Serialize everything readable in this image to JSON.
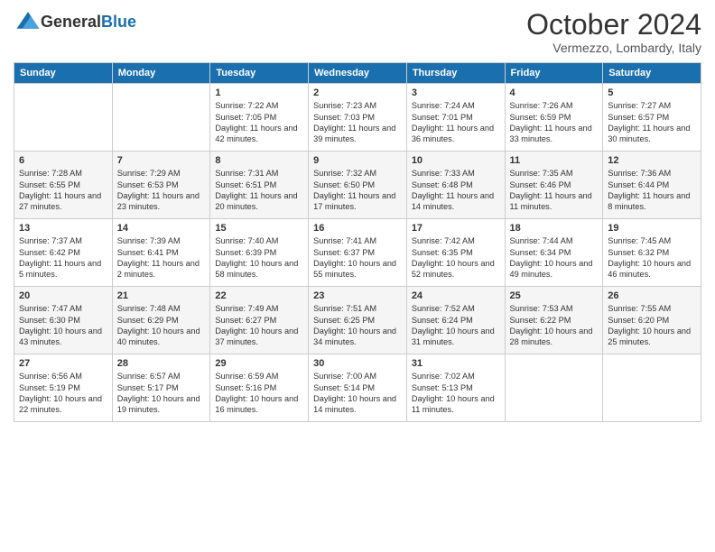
{
  "header": {
    "logo_general": "General",
    "logo_blue": "Blue",
    "month": "October 2024",
    "location": "Vermezzo, Lombardy, Italy"
  },
  "weekdays": [
    "Sunday",
    "Monday",
    "Tuesday",
    "Wednesday",
    "Thursday",
    "Friday",
    "Saturday"
  ],
  "weeks": [
    [
      {
        "day": "",
        "info": ""
      },
      {
        "day": "",
        "info": ""
      },
      {
        "day": "1",
        "info": "Sunrise: 7:22 AM\nSunset: 7:05 PM\nDaylight: 11 hours and 42 minutes."
      },
      {
        "day": "2",
        "info": "Sunrise: 7:23 AM\nSunset: 7:03 PM\nDaylight: 11 hours and 39 minutes."
      },
      {
        "day": "3",
        "info": "Sunrise: 7:24 AM\nSunset: 7:01 PM\nDaylight: 11 hours and 36 minutes."
      },
      {
        "day": "4",
        "info": "Sunrise: 7:26 AM\nSunset: 6:59 PM\nDaylight: 11 hours and 33 minutes."
      },
      {
        "day": "5",
        "info": "Sunrise: 7:27 AM\nSunset: 6:57 PM\nDaylight: 11 hours and 30 minutes."
      }
    ],
    [
      {
        "day": "6",
        "info": "Sunrise: 7:28 AM\nSunset: 6:55 PM\nDaylight: 11 hours and 27 minutes."
      },
      {
        "day": "7",
        "info": "Sunrise: 7:29 AM\nSunset: 6:53 PM\nDaylight: 11 hours and 23 minutes."
      },
      {
        "day": "8",
        "info": "Sunrise: 7:31 AM\nSunset: 6:51 PM\nDaylight: 11 hours and 20 minutes."
      },
      {
        "day": "9",
        "info": "Sunrise: 7:32 AM\nSunset: 6:50 PM\nDaylight: 11 hours and 17 minutes."
      },
      {
        "day": "10",
        "info": "Sunrise: 7:33 AM\nSunset: 6:48 PM\nDaylight: 11 hours and 14 minutes."
      },
      {
        "day": "11",
        "info": "Sunrise: 7:35 AM\nSunset: 6:46 PM\nDaylight: 11 hours and 11 minutes."
      },
      {
        "day": "12",
        "info": "Sunrise: 7:36 AM\nSunset: 6:44 PM\nDaylight: 11 hours and 8 minutes."
      }
    ],
    [
      {
        "day": "13",
        "info": "Sunrise: 7:37 AM\nSunset: 6:42 PM\nDaylight: 11 hours and 5 minutes."
      },
      {
        "day": "14",
        "info": "Sunrise: 7:39 AM\nSunset: 6:41 PM\nDaylight: 11 hours and 2 minutes."
      },
      {
        "day": "15",
        "info": "Sunrise: 7:40 AM\nSunset: 6:39 PM\nDaylight: 10 hours and 58 minutes."
      },
      {
        "day": "16",
        "info": "Sunrise: 7:41 AM\nSunset: 6:37 PM\nDaylight: 10 hours and 55 minutes."
      },
      {
        "day": "17",
        "info": "Sunrise: 7:42 AM\nSunset: 6:35 PM\nDaylight: 10 hours and 52 minutes."
      },
      {
        "day": "18",
        "info": "Sunrise: 7:44 AM\nSunset: 6:34 PM\nDaylight: 10 hours and 49 minutes."
      },
      {
        "day": "19",
        "info": "Sunrise: 7:45 AM\nSunset: 6:32 PM\nDaylight: 10 hours and 46 minutes."
      }
    ],
    [
      {
        "day": "20",
        "info": "Sunrise: 7:47 AM\nSunset: 6:30 PM\nDaylight: 10 hours and 43 minutes."
      },
      {
        "day": "21",
        "info": "Sunrise: 7:48 AM\nSunset: 6:29 PM\nDaylight: 10 hours and 40 minutes."
      },
      {
        "day": "22",
        "info": "Sunrise: 7:49 AM\nSunset: 6:27 PM\nDaylight: 10 hours and 37 minutes."
      },
      {
        "day": "23",
        "info": "Sunrise: 7:51 AM\nSunset: 6:25 PM\nDaylight: 10 hours and 34 minutes."
      },
      {
        "day": "24",
        "info": "Sunrise: 7:52 AM\nSunset: 6:24 PM\nDaylight: 10 hours and 31 minutes."
      },
      {
        "day": "25",
        "info": "Sunrise: 7:53 AM\nSunset: 6:22 PM\nDaylight: 10 hours and 28 minutes."
      },
      {
        "day": "26",
        "info": "Sunrise: 7:55 AM\nSunset: 6:20 PM\nDaylight: 10 hours and 25 minutes."
      }
    ],
    [
      {
        "day": "27",
        "info": "Sunrise: 6:56 AM\nSunset: 5:19 PM\nDaylight: 10 hours and 22 minutes."
      },
      {
        "day": "28",
        "info": "Sunrise: 6:57 AM\nSunset: 5:17 PM\nDaylight: 10 hours and 19 minutes."
      },
      {
        "day": "29",
        "info": "Sunrise: 6:59 AM\nSunset: 5:16 PM\nDaylight: 10 hours and 16 minutes."
      },
      {
        "day": "30",
        "info": "Sunrise: 7:00 AM\nSunset: 5:14 PM\nDaylight: 10 hours and 14 minutes."
      },
      {
        "day": "31",
        "info": "Sunrise: 7:02 AM\nSunset: 5:13 PM\nDaylight: 10 hours and 11 minutes."
      },
      {
        "day": "",
        "info": ""
      },
      {
        "day": "",
        "info": ""
      }
    ]
  ]
}
